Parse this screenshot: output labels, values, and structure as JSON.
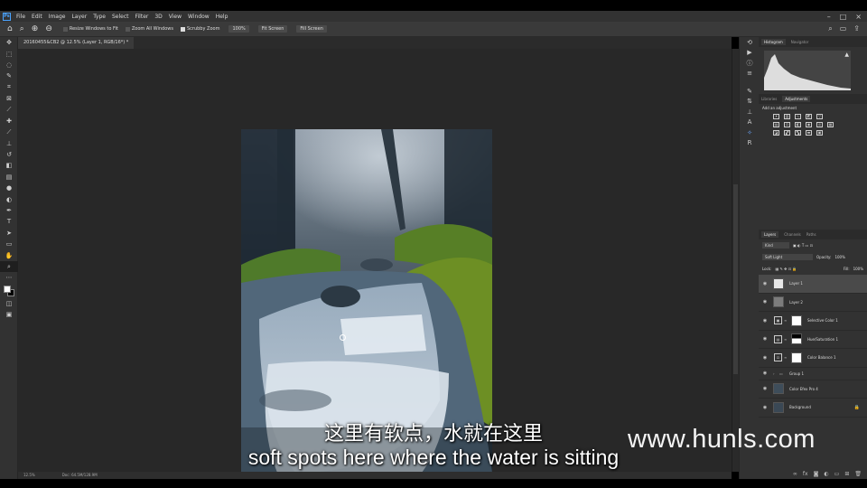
{
  "app": {
    "logo_text": "Ps"
  },
  "menubar": {
    "items": [
      "File",
      "Edit",
      "Image",
      "Layer",
      "Type",
      "Select",
      "Filter",
      "3D",
      "View",
      "Window",
      "Help"
    ]
  },
  "options_bar": {
    "resize_windows": "Resize Windows to Fit",
    "zoom_all_windows": "Zoom All Windows",
    "scrubby_zoom": "Scrubby Zoom",
    "zoom_value": "100%",
    "fit_screen": "Fit Screen",
    "fill_screen": "Fill Screen"
  },
  "document": {
    "tab_title": "20160455&CB2 @ 12.5% (Layer 1, RGB/16*) *"
  },
  "status_bar": {
    "zoom": "12.5%",
    "doc_info": "Doc: 64.5M/128.9M"
  },
  "panels": {
    "top_tabs": [
      "Histogram",
      "Navigator"
    ],
    "adjust_tabs": [
      "Libraries",
      "Adjustments"
    ],
    "adjust_title": "Add an adjustment",
    "layer_tabs": [
      "Layers",
      "Channels",
      "Paths"
    ],
    "kind_label": "Kind",
    "blend_mode": "Soft Light",
    "opacity_label": "Opacity:",
    "opacity_value": "100%",
    "lock_label": "Lock:",
    "fill_label": "Fill:",
    "fill_value": "100%",
    "layers": [
      {
        "name": "Layer 1"
      },
      {
        "name": "Layer 2"
      },
      {
        "name": "Selective Color 1"
      },
      {
        "name": "Hue/Saturation 1"
      },
      {
        "name": "Color Balance 1"
      },
      {
        "name": "Group 1"
      },
      {
        "name": "Color Efex Pro 4"
      },
      {
        "name": "Background"
      }
    ]
  },
  "subtitles": {
    "chinese": "这里有软点，水就在这里",
    "english": "soft spots here where the water is sitting"
  },
  "watermark": "www.hunls.com",
  "colors": {
    "menubar_bg": "#323232",
    "canvas_bg": "#282828",
    "panel_bg": "#323232",
    "selected_layer_bg": "#4a4a4a",
    "logo_accent": "#4aa3ff"
  }
}
